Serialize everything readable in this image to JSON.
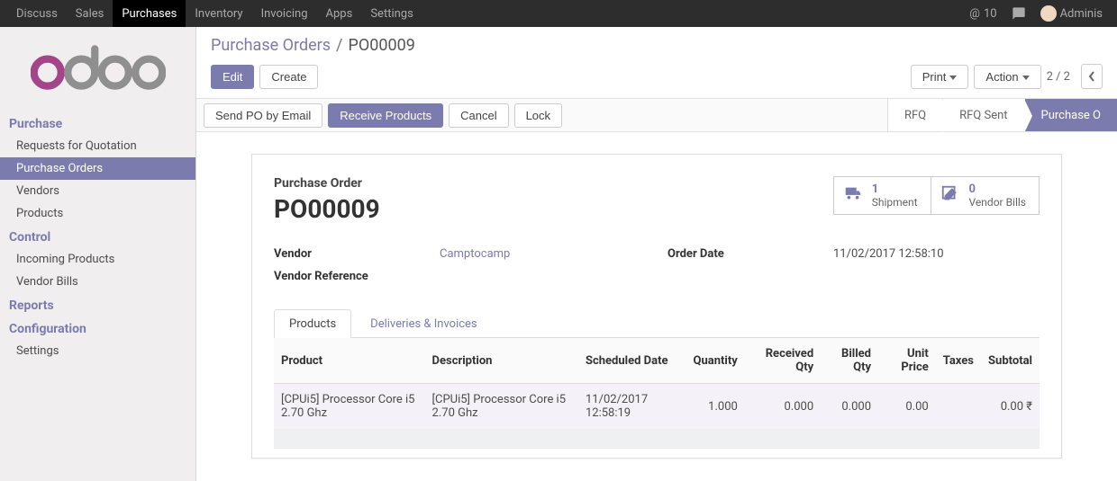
{
  "topnav": {
    "items": [
      "Discuss",
      "Sales",
      "Purchases",
      "Inventory",
      "Invoicing",
      "Apps",
      "Settings"
    ],
    "active_index": 2,
    "mail_count": "10",
    "user_name": "Adminis"
  },
  "sidebar": {
    "sections": [
      {
        "title": "Purchase",
        "items": [
          "Requests for Quotation",
          "Purchase Orders",
          "Vendors",
          "Products"
        ],
        "active_item": 1
      },
      {
        "title": "Control",
        "items": [
          "Incoming Products",
          "Vendor Bills"
        ],
        "active_item": -1
      },
      {
        "title": "Reports",
        "items": [],
        "active_item": -1
      },
      {
        "title": "Configuration",
        "items": [
          "Settings"
        ],
        "active_item": -1
      }
    ]
  },
  "breadcrumb": {
    "root": "Purchase Orders",
    "current": "PO00009"
  },
  "toolbar": {
    "edit": "Edit",
    "create": "Create",
    "print": "Print",
    "action": "Action",
    "pager": "2 / 2"
  },
  "statusbar": {
    "buttons": [
      "Send PO by Email",
      "Receive Products",
      "Cancel",
      "Lock"
    ],
    "active_button_index": 1,
    "stages": [
      "RFQ",
      "RFQ Sent",
      "Purchase O"
    ],
    "active_stage_index": 2
  },
  "record": {
    "subtitle": "Purchase Order",
    "name": "PO00009",
    "stats": [
      {
        "icon": "truck",
        "count": "1",
        "label": "Shipment"
      },
      {
        "icon": "pencil-square",
        "count": "0",
        "label": "Vendor Bills"
      }
    ],
    "fields": {
      "vendor_label": "Vendor",
      "vendor_value": "Camptocamp",
      "vendor_ref_label": "Vendor Reference",
      "vendor_ref_value": "",
      "order_date_label": "Order Date",
      "order_date_value": "11/02/2017 12:58:10"
    },
    "tabs": [
      "Products",
      "Deliveries & Invoices"
    ],
    "active_tab": 0,
    "table": {
      "headers": [
        "Product",
        "Description",
        "Scheduled Date",
        "Quantity",
        "Received Qty",
        "Billed Qty",
        "Unit Price",
        "Taxes",
        "Subtotal"
      ],
      "rows": [
        {
          "product": "[CPUi5] Processor Core i5 2.70 Ghz",
          "description": "[CPUi5] Processor Core i5 2.70 Ghz",
          "scheduled": "11/02/2017 12:58:19",
          "quantity": "1.000",
          "received": "0.000",
          "billed": "0.000",
          "unit_price": "0.00",
          "taxes": "",
          "subtotal": "0.00 ₹"
        }
      ]
    }
  }
}
